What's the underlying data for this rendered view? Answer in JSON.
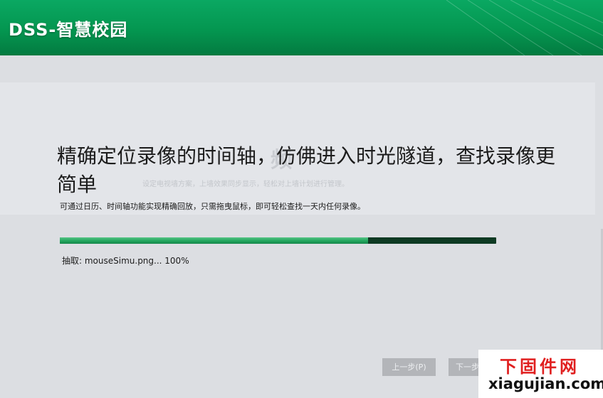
{
  "header": {
    "app_title": "DSS-智慧校园"
  },
  "background_ghost": {
    "heading": "频",
    "subtext": "设定电视墙方案，上墙效果同步显示，轻松对上墙计划进行管理。"
  },
  "main": {
    "headline": "精确定位录像的时间轴，仿佛进入时光隧道，查找录像更简单",
    "subline": "可通过日历、时间轴功能实现精确回放，只需拖曳鼠标，即可轻松查找一天内任何录像。"
  },
  "progress": {
    "fraction": 0.707,
    "status_text": "抽取: mouseSimu.png... 100%"
  },
  "buttons": {
    "prev_label": "上一步(P)",
    "next_label": "下一步"
  },
  "watermark": {
    "top_text": "下固件网",
    "bottom_text": "xiagujian.com"
  },
  "colors": {
    "header_green": "#049650",
    "progress_fill": "#25a860",
    "progress_track": "#0e3a23",
    "button_bg": "#b3b5b9"
  }
}
